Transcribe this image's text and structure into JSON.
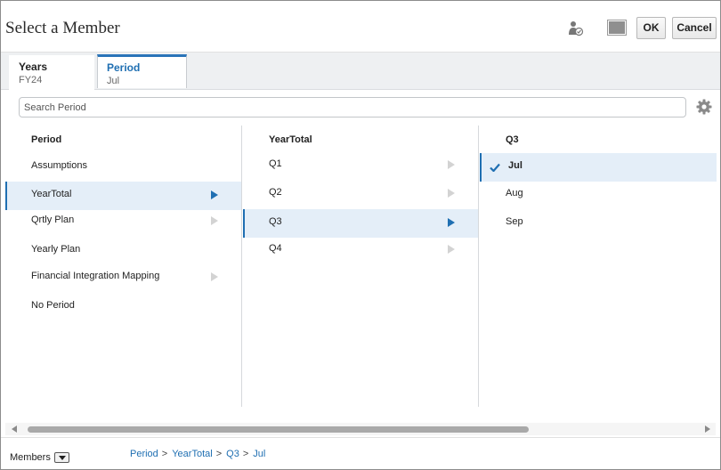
{
  "dialog": {
    "title": "Select a Member"
  },
  "header": {
    "ok_label": "OK",
    "cancel_label": "Cancel"
  },
  "tabs": [
    {
      "dimension": "Years",
      "value": "FY24"
    },
    {
      "dimension": "Period",
      "value": "Jul"
    }
  ],
  "search": {
    "placeholder": "Search Period"
  },
  "columns": [
    {
      "header": "Period",
      "items": [
        {
          "label": "Assumptions"
        },
        {
          "label": "YearTotal"
        },
        {
          "label": "Qrtly Plan"
        },
        {
          "label": "Yearly Plan"
        },
        {
          "label": "Financial Integration Mapping"
        },
        {
          "label": "No Period"
        }
      ]
    },
    {
      "header": "YearTotal",
      "items": [
        {
          "label": "Q1"
        },
        {
          "label": "Q2"
        },
        {
          "label": "Q3"
        },
        {
          "label": "Q4"
        }
      ]
    },
    {
      "header": "Q3",
      "items": [
        {
          "label": "Jul"
        },
        {
          "label": "Aug"
        },
        {
          "label": "Sep"
        }
      ]
    }
  ],
  "footer": {
    "members_label": "Members",
    "breadcrumb": [
      "Period",
      "YearTotal",
      "Q3",
      "Jul"
    ],
    "separator": ">"
  },
  "colors": {
    "accent": "#1f6fb2",
    "selected_row": "#e4eef8"
  }
}
